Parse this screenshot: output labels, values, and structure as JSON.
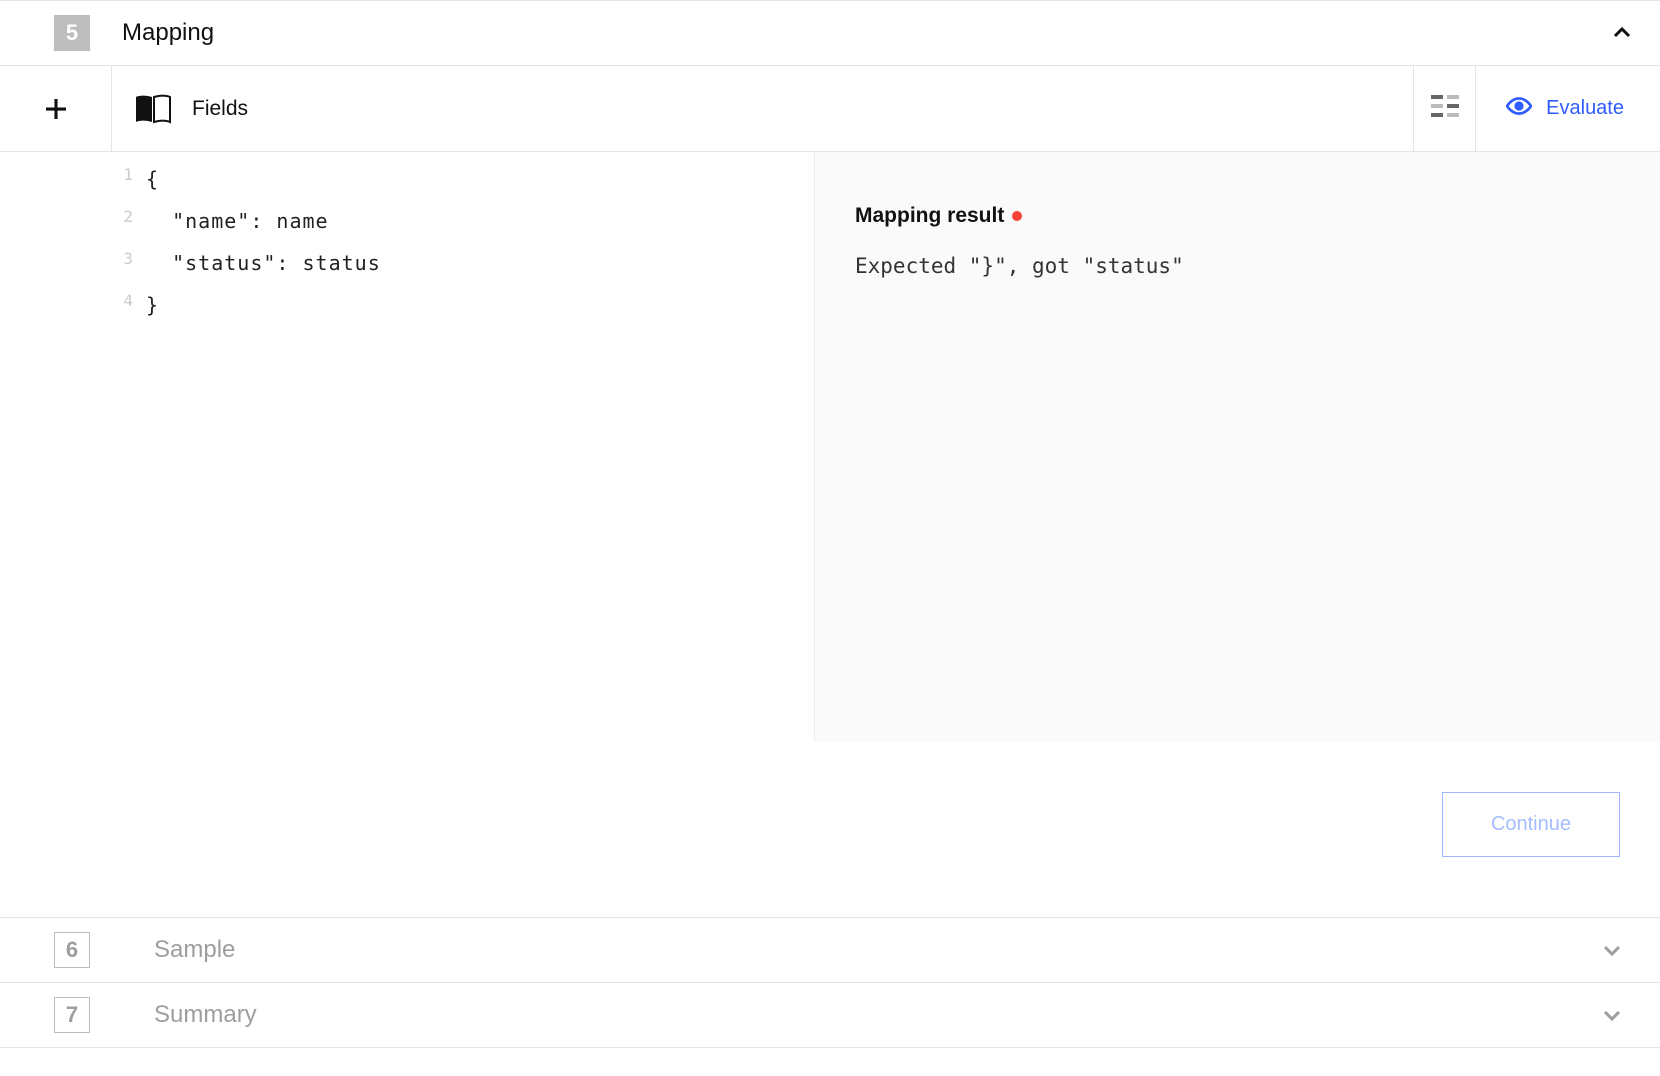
{
  "steps": {
    "mapping": {
      "num": "5",
      "title": "Mapping"
    },
    "sample": {
      "num": "6",
      "title": "Sample"
    },
    "summary": {
      "num": "7",
      "title": "Summary"
    }
  },
  "toolbar": {
    "fields_label": "Fields",
    "evaluate_label": "Evaluate"
  },
  "editor": {
    "lines": [
      {
        "n": "1",
        "text": "{"
      },
      {
        "n": "2",
        "text": "  \"name\": name"
      },
      {
        "n": "3",
        "text": "  \"status\": status"
      },
      {
        "n": "4",
        "text": "}"
      }
    ]
  },
  "result": {
    "title": "Mapping result",
    "message": "Expected \"}\", got \"status\""
  },
  "actions": {
    "continue_label": "Continue"
  }
}
